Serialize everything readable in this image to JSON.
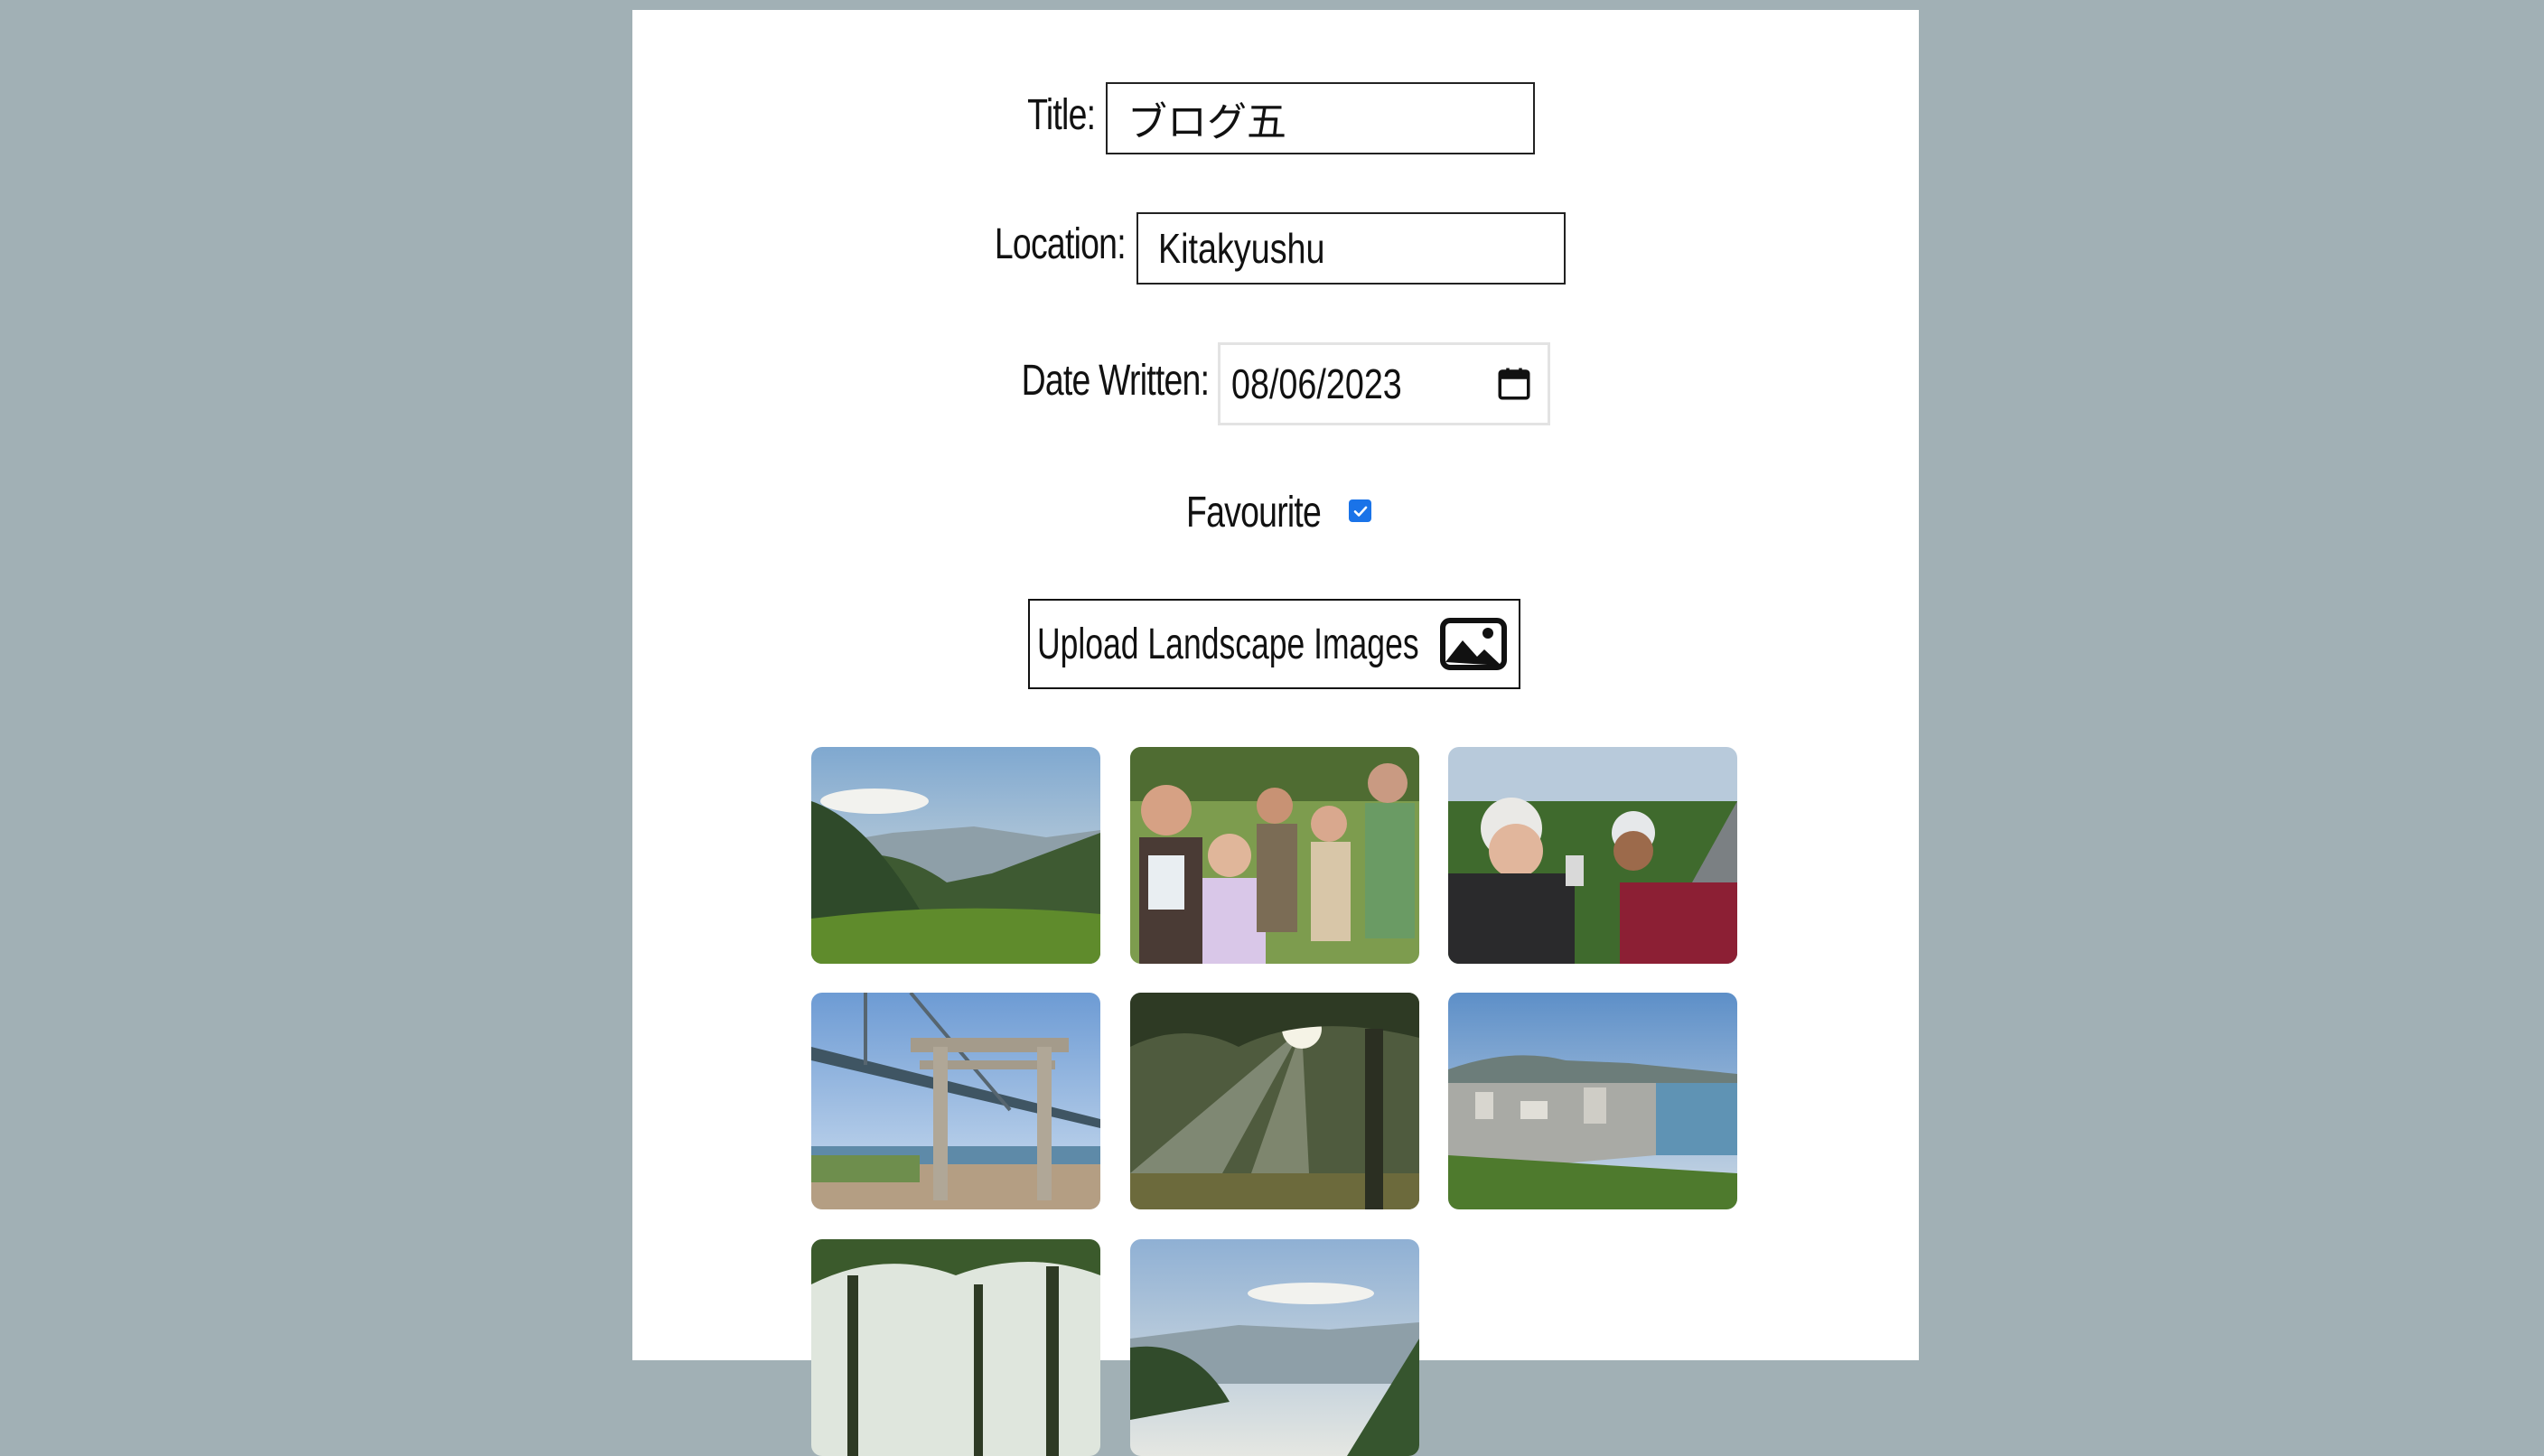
{
  "form": {
    "title_label": "Title:",
    "title_value": "ブログ五",
    "location_label": "Location:",
    "location_value": "Kitakyushu",
    "date_label": "Date Written:",
    "date_value": "08/06/2023",
    "favourite_label": "Favourite",
    "favourite_checked": true,
    "upload_label": "Upload Landscape Images"
  },
  "gallery": {
    "images": [
      {
        "name": "mountain-bay-view"
      },
      {
        "name": "group-selfie-park"
      },
      {
        "name": "cyclists-selfie"
      },
      {
        "name": "torii-gate-bridge"
      },
      {
        "name": "forest-sun-rays"
      },
      {
        "name": "city-harbour-view"
      },
      {
        "name": "forest-trees"
      },
      {
        "name": "mountain-view-2"
      }
    ]
  },
  "colors": {
    "background": "#a1b0b5",
    "panel": "#ffffff",
    "checkbox": "#1a73e8"
  },
  "icons": {
    "date": "calendar-icon",
    "upload": "image-icon",
    "checkbox": "checkmark-icon"
  }
}
